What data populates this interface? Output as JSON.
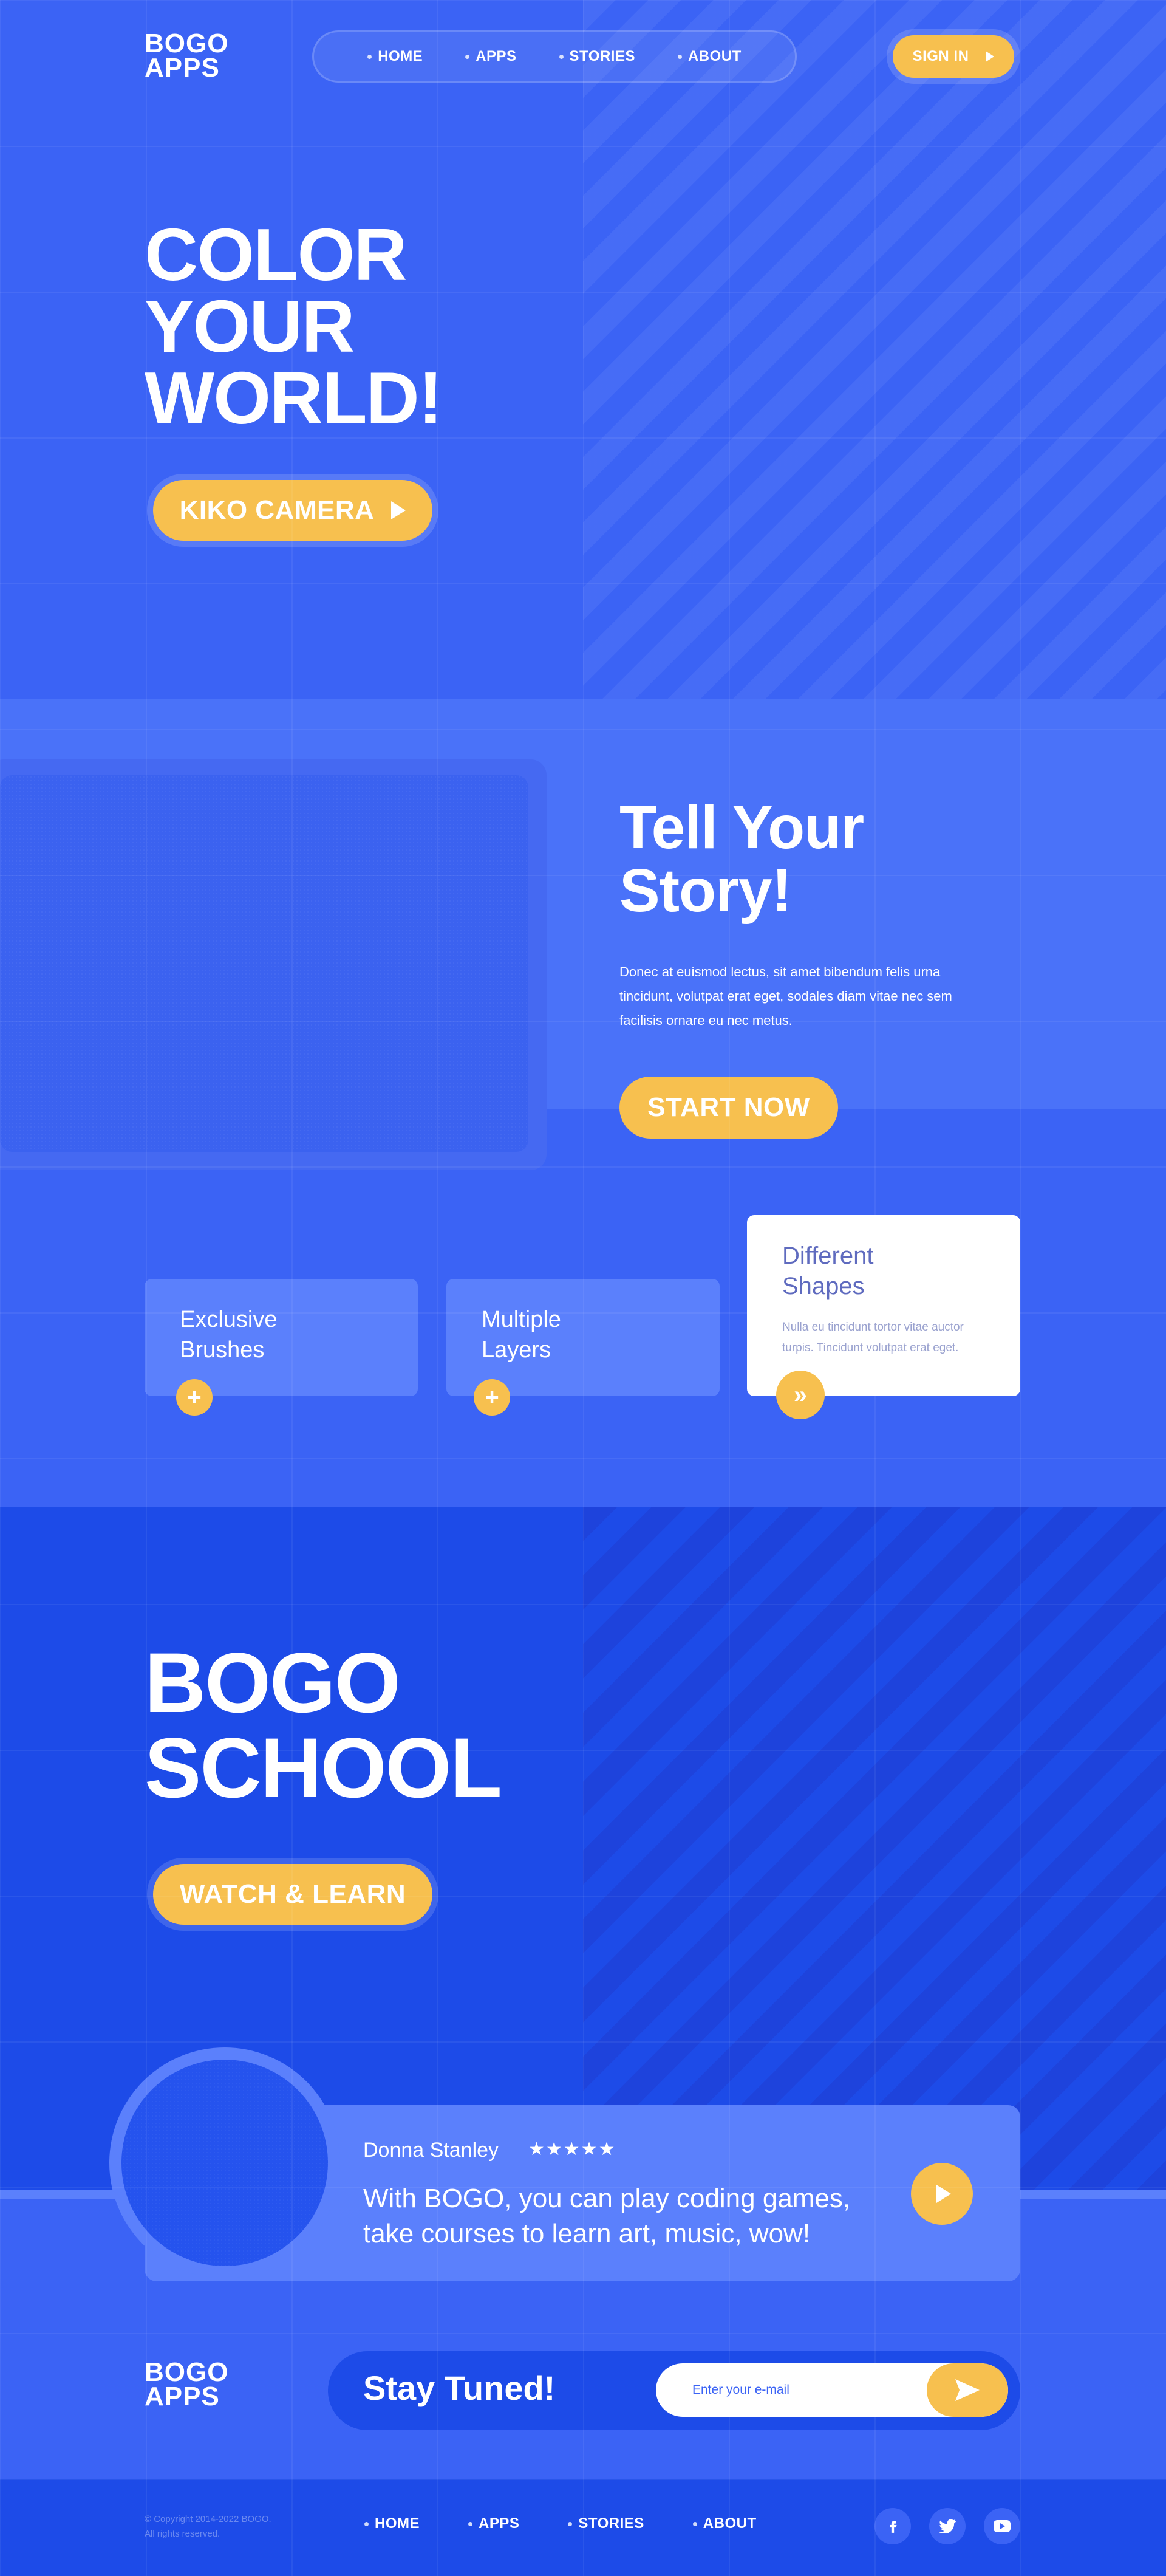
{
  "brand": {
    "logo_line1": "BOGO",
    "logo_line2": "APPS"
  },
  "nav": {
    "items": [
      {
        "label": "HOME"
      },
      {
        "label": "APPS"
      },
      {
        "label": "STORIES"
      },
      {
        "label": "ABOUT"
      }
    ],
    "signin_label": "SIGN IN"
  },
  "hero": {
    "title_line1": "COLOR",
    "title_line2": "YOUR",
    "title_line3": "WORLD!",
    "cta_label": "KIKO CAMERA"
  },
  "story": {
    "title_line1": "Tell Your",
    "title_line2": "Story!",
    "body": "Donec at euismod lectus, sit amet bibendum felis urna tincidunt, volutpat erat eget, sodales diam vitae nec sem facilisis ornare eu nec metus.",
    "cta_label": "START NOW"
  },
  "features": [
    {
      "line1": "Exclusive",
      "line2": "Brushes",
      "button": "+"
    },
    {
      "line1": "Multiple",
      "line2": "Layers",
      "button": "+"
    },
    {
      "line1": "Different",
      "line2": "Shapes",
      "body": "Nulla eu tincidunt tortor vitae auctor turpis. Tincidunt volutpat erat eget.",
      "button": "»"
    }
  ],
  "school": {
    "title_line1": "BOGO",
    "title_line2": "SCHOOL",
    "cta_label": "WATCH & LEARN"
  },
  "testimonial": {
    "name": "Donna Stanley",
    "stars": "★★★★★",
    "rating": 5,
    "quote": "With BOGO, you can play coding games, take courses to learn art, music, wow!"
  },
  "newsletter": {
    "title": "Stay Tuned!",
    "placeholder": "Enter your e-mail"
  },
  "footer": {
    "copyright_line1": "© Copyright 2014-2022 BOGO.",
    "copyright_line2": "All rights reserved.",
    "nav": [
      {
        "label": "HOME"
      },
      {
        "label": "APPS"
      },
      {
        "label": "STORIES"
      },
      {
        "label": "ABOUT"
      }
    ],
    "social": [
      "facebook-icon",
      "twitter-icon",
      "youtube-icon"
    ]
  },
  "colors": {
    "primary_blue": "#3b63f5",
    "dark_blue": "#1d4be8",
    "light_blue": "#5b80fc",
    "accent_yellow": "#f7c04f"
  }
}
